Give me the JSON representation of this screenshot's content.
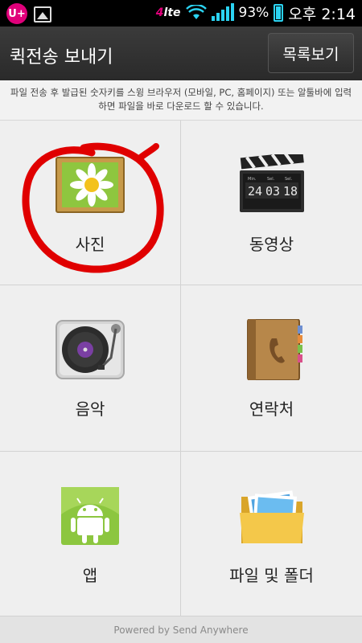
{
  "status_bar": {
    "carrier_badge": "U+",
    "network": "4G LTE",
    "battery": "93%",
    "time": "오후 2:14",
    "accent_color": "#2bd3f2"
  },
  "header": {
    "title": "퀵전송 보내기",
    "list_button": "목록보기"
  },
  "info_text": "파일 전송 후 발급된 숫자키를 스윙 브라우저 (모바일, PC, 홈페이지) 또는 알툴바에 입력하면 파일을 바로 다운로드 할 수 있습니다.",
  "categories": [
    {
      "label": "사진",
      "icon": "photo-icon"
    },
    {
      "label": "동영상",
      "icon": "video-icon"
    },
    {
      "label": "음악",
      "icon": "music-icon"
    },
    {
      "label": "연락처",
      "icon": "contacts-icon"
    },
    {
      "label": "앱",
      "icon": "app-icon"
    },
    {
      "label": "파일 및 폴더",
      "icon": "folder-icon"
    }
  ],
  "clapper": {
    "d1": "24",
    "d2": "03",
    "d3": "18",
    "h1": "Min.",
    "h2": "Sel.",
    "h3": "Sel."
  },
  "footer": "Powered by Send Anywhere",
  "annotation_color": "#e00000"
}
